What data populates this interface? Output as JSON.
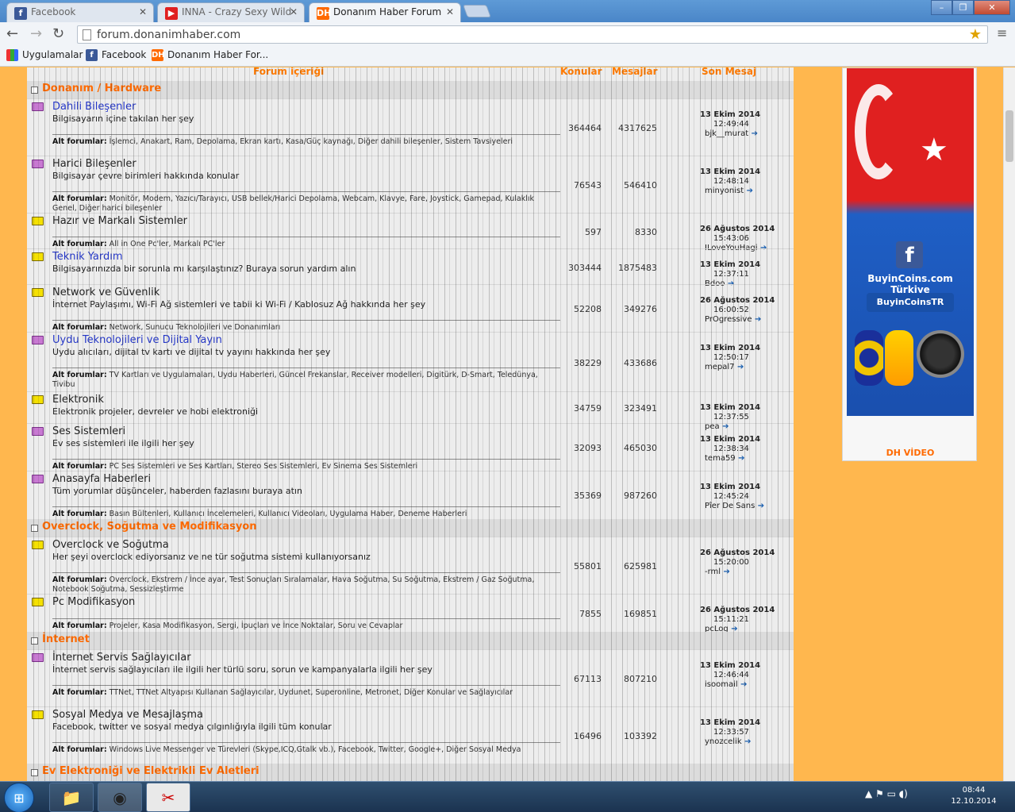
{
  "tabs": [
    {
      "title": "Facebook",
      "icon": "facebook-icon",
      "color": "#3b5998"
    },
    {
      "title": "INNA - Crazy Sexy Wild",
      "icon": "youtube-icon",
      "color": "#e02020"
    },
    {
      "title": "Donanım Haber Forum",
      "icon": "dh-icon",
      "color": "#ff6a00"
    }
  ],
  "window_controls": {
    "minimize": "–",
    "maximize": "❐",
    "close": "✕"
  },
  "url": "forum.donanimhaber.com",
  "bookmarks": [
    "Uygulamalar",
    "Facebook",
    "Donanım Haber For..."
  ],
  "columns": {
    "content": "Forum içeriği",
    "topics": "Konular",
    "messages": "Mesajlar",
    "last": "Son Mesaj"
  },
  "categories": [
    {
      "title": "Donanım / Hardware",
      "forums": [
        {
          "title": "Dahili Bileşenler",
          "new": true,
          "link": true,
          "desc": "Bilgisayarın içine takılan her şey",
          "subs_label": "Alt forumlar:",
          "subs": "İşlemci, Anakart, Ram, Depolama, Ekran kartı, Kasa/Güç kaynağı, Diğer dahili bileşenler, Sistem Tavsiyeleri",
          "topics": "364464",
          "messages": "4317625",
          "date": "13 Ekim 2014",
          "time": "12:49:44",
          "user": "bjk__murat"
        },
        {
          "title": "Harici Bileşenler",
          "new": true,
          "link": false,
          "desc": "Bilgisayar çevre birimleri hakkında konular",
          "subs_label": "Alt forumlar:",
          "subs": "Monitör, Modem, Yazıcı/Tarayıcı, USB bellek/Harici Depolama, Webcam, Klavye, Fare, Joystick, Gamepad, Kulaklık Genel, Diğer harici bileşenler",
          "topics": "76543",
          "messages": "546410",
          "date": "13 Ekim 2014",
          "time": "12:48:14",
          "user": "minyonist"
        },
        {
          "title": "Hazır ve Markalı Sistemler",
          "new": false,
          "link": false,
          "desc": "",
          "subs_label": "Alt forumlar:",
          "subs": "All in One Pc'ler, Markalı PC'ler",
          "topics": "597",
          "messages": "8330",
          "date": "26 Ağustos 2014",
          "time": "15:43:06",
          "user": "ILoveYouHagi"
        },
        {
          "title": "Teknik Yardım",
          "new": false,
          "link": true,
          "desc": "Bilgisayarınızda bir sorunla mı karşılaştınız? Buraya sorun yardım alın",
          "subs_label": "",
          "subs": "",
          "topics": "303444",
          "messages": "1875483",
          "date": "13 Ekim 2014",
          "time": "12:37:11",
          "user": "Bdoo"
        },
        {
          "title": "Network ve Güvenlik",
          "new": false,
          "link": false,
          "desc": "İnternet Paylaşımı, Wi-Fi Ağ sistemleri ve tabii ki Wi-Fi / Kablosuz Ağ hakkında her şey",
          "subs_label": "Alt forumlar:",
          "subs": "Network, Sunucu Teknolojileri ve Donanımları",
          "topics": "52208",
          "messages": "349276",
          "date": "26 Ağustos 2014",
          "time": "16:00:52",
          "user": "PrOgressive"
        },
        {
          "title": "Uydu Teknolojileri ve Dijital Yayın",
          "new": true,
          "link": true,
          "desc": "Uydu alıcıları, dijital tv kartı ve dijital tv yayını hakkında her şey",
          "subs_label": "Alt forumlar:",
          "subs": "TV Kartları ve Uygulamaları, Uydu Haberleri, Güncel Frekanslar, Receiver modelleri, Digitürk, D-Smart, Teledünya, Tivibu",
          "topics": "38229",
          "messages": "433686",
          "date": "13 Ekim 2014",
          "time": "12:50:17",
          "user": "mepal7"
        },
        {
          "title": "Elektronik",
          "new": false,
          "link": false,
          "desc": "Elektronik projeler, devreler ve hobi elektroniği",
          "subs_label": "",
          "subs": "",
          "topics": "34759",
          "messages": "323491",
          "date": "13 Ekim 2014",
          "time": "12:37:55",
          "user": "pea"
        },
        {
          "title": "Ses Sistemleri",
          "new": true,
          "link": false,
          "desc": "Ev ses sistemleri ile ilgili her şey",
          "subs_label": "Alt forumlar:",
          "subs": "PC Ses Sistemleri ve Ses Kartları, Stereo Ses Sistemleri, Ev Sinema Ses Sistemleri",
          "topics": "32093",
          "messages": "465030",
          "date": "13 Ekim 2014",
          "time": "12:38:34",
          "user": "tema59"
        },
        {
          "title": "Anasayfa Haberleri",
          "new": true,
          "link": false,
          "desc": "Tüm yorumlar düşünceler, haberden fazlasını buraya atın",
          "subs_label": "Alt forumlar:",
          "subs": "Basın Bültenleri, Kullanıcı İncelemeleri, Kullanıcı Videoları, Uygulama Haber, Deneme Haberleri",
          "topics": "35369",
          "messages": "987260",
          "date": "13 Ekim 2014",
          "time": "12:45:24",
          "user": "Pîer De Sans"
        }
      ]
    },
    {
      "title": "Overclock, Soğutma ve Modifikasyon",
      "forums": [
        {
          "title": "Overclock ve Soğutma",
          "new": false,
          "link": false,
          "desc": "Her şeyi overclock ediyorsanız ve ne tür soğutma sistemi kullanıyorsanız",
          "subs_label": "Alt forumlar:",
          "subs": "Overclock, Ekstrem / İnce ayar, Test Sonuçları Sıralamalar, Hava Soğutma, Su Soğutma, Ekstrem / Gaz Soğutma, Notebook Soğutma, Sessizleştirme",
          "topics": "55801",
          "messages": "625981",
          "date": "26 Ağustos 2014",
          "time": "15:20:00",
          "user": "-rml"
        },
        {
          "title": "Pc Modifikasyon",
          "new": false,
          "link": false,
          "desc": "",
          "subs_label": "Alt forumlar:",
          "subs": "Projeler, Kasa Modifikasyon, Sergi, İpuçları ve İnce Noktalar, Soru ve Cevaplar",
          "topics": "7855",
          "messages": "169851",
          "date": "26 Ağustos 2014",
          "time": "15:11:21",
          "user": "pcLog"
        }
      ]
    },
    {
      "title": "İnternet",
      "forums": [
        {
          "title": "İnternet Servis Sağlayıcılar",
          "new": true,
          "link": false,
          "desc": "İnternet servis sağlayıcıları ile ilgili her türlü soru, sorun ve kampanyalarla ilgili her şey",
          "subs_label": "Alt forumlar:",
          "subs": "TTNet, TTNet Altyapısı Kullanan Sağlayıcılar, Uydunet, Superonline, Metronet, Diğer Konular ve Sağlayıcılar",
          "topics": "67113",
          "messages": "807210",
          "date": "13 Ekim 2014",
          "time": "12:46:44",
          "user": "isoomail"
        },
        {
          "title": "Sosyal Medya ve Mesajlaşma",
          "new": false,
          "link": false,
          "desc": "Facebook, twitter ve sosyal medya çılgınlığıyla ilgili tüm konular",
          "subs_label": "Alt forumlar:",
          "subs": "Windows Live Messenger ve Türevleri (Skype,ICQ,Gtalk vb.), Facebook, Twitter, Google+, Diğer Sosyal Medya",
          "topics": "16496",
          "messages": "103392",
          "date": "13 Ekim 2014",
          "time": "12:33:57",
          "user": "ynozcelik"
        }
      ]
    },
    {
      "title": "Ev Elektroniği ve Elektrikli Ev Aletleri",
      "forums": []
    }
  ],
  "sidebar": {
    "ad_text1": "BuyinCoins.com Türkiye",
    "ad_text2": "BuyinCoinsTR",
    "video_label": "DH VİDEO"
  },
  "taskbar": {
    "time": "08:44",
    "date": "12.10.2014"
  }
}
